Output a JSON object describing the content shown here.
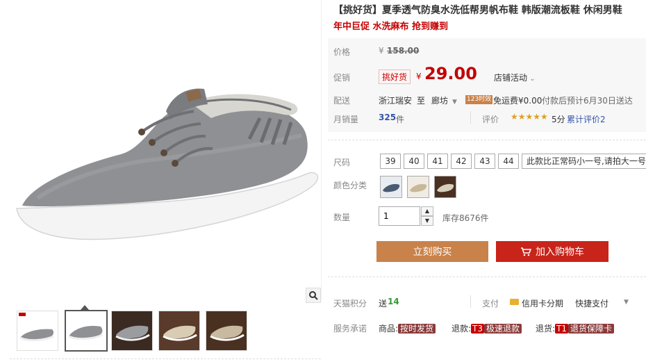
{
  "product": {
    "title": "【挑好货】夏季透气防臭水洗低帮男帆布鞋 韩版潮流板鞋 休闲男鞋",
    "promo": "年中巨促 水洗麻布 抢到赚到"
  },
  "price": {
    "label": "价格",
    "currency": "¥",
    "original": "158.00",
    "promo_label": "促销",
    "badge": "挑好货",
    "current": "29.00",
    "store_activity": "店铺活动"
  },
  "shipping": {
    "label": "配送",
    "from": "浙江瑞安",
    "to_word": "至",
    "to": "廊坊",
    "time_badge": "123时效",
    "fee": "免运费¥0.00",
    "eta": "付款后预计6月30日送达"
  },
  "sales": {
    "label": "月销量",
    "count": "325",
    "unit": "件",
    "rating_label": "评价",
    "stars": "★★★★★",
    "score": "5分",
    "reviews": "累计评价2"
  },
  "sizes": {
    "label": "尺码",
    "options": [
      "39",
      "40",
      "41",
      "42",
      "43",
      "44"
    ],
    "note": "此款比正常码小一号,请拍大一号"
  },
  "colors": {
    "label": "颜色分类"
  },
  "quantity": {
    "label": "数量",
    "value": "1",
    "stock": "库存8676件"
  },
  "actions": {
    "buy_now": "立刻购买",
    "add_cart": "加入购物车"
  },
  "service": {
    "points_label": "天猫积分",
    "points_prefix": "送",
    "points_value": "14",
    "pay_label": "支付",
    "credit": "信用卡分期",
    "quick_pay": "快捷支付",
    "promise_label": "服务承诺",
    "goods": "商品:",
    "goods_tag": "按时发货",
    "refund": "退款:",
    "refund_code": "T3",
    "refund_tag": "极速退款",
    "return": "退货:",
    "return_code": "T1",
    "return_tag": "退货保障卡"
  },
  "colors_theme": {
    "price_red": "#c40000",
    "buy_orange": "#c8824a",
    "cart_red": "#c8241a",
    "link_blue": "#3355aa",
    "points_green": "#339933"
  }
}
